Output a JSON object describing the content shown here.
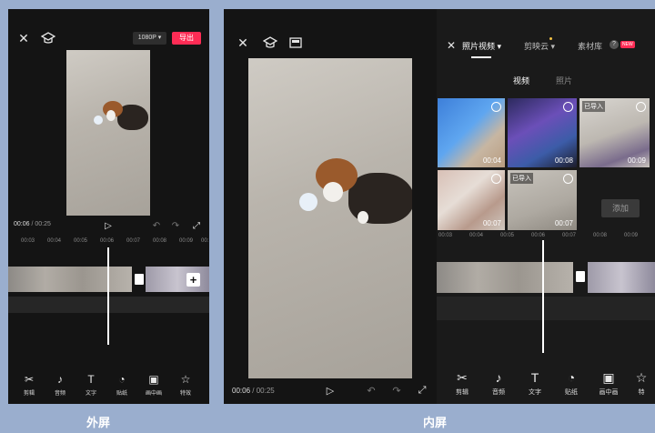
{
  "outer": {
    "caption": "外屏",
    "resolution": "1080P",
    "export_label": "导出",
    "time_current": "00:06",
    "time_total": "/ 00:25",
    "ruler": [
      "00:03",
      "00:04",
      "00:05",
      "00:06",
      "00:07",
      "00:08",
      "00:09",
      "00:"
    ],
    "tools": [
      {
        "label": "剪辑",
        "icon": "scissors-icon",
        "glyph": "✂"
      },
      {
        "label": "音频",
        "icon": "music-note-icon",
        "glyph": "♪"
      },
      {
        "label": "文字",
        "icon": "text-icon",
        "glyph": "T"
      },
      {
        "label": "贴纸",
        "icon": "sticker-icon",
        "glyph": "◔"
      },
      {
        "label": "画中画",
        "icon": "picture-in-picture-icon",
        "glyph": "▣"
      },
      {
        "label": "特效",
        "icon": "effects-star-icon",
        "glyph": "☆"
      }
    ]
  },
  "inner": {
    "caption": "内屏",
    "time_current": "00:06",
    "time_total": "/ 00:25",
    "tabs": {
      "photo_video": "照片视频",
      "cloud": "剪映云",
      "library": "素材库",
      "new_badge": "NEW",
      "help": "?"
    },
    "subtabs": {
      "video": "视频",
      "photo": "照片"
    },
    "thumbnails": [
      {
        "duration": "00:04",
        "imported": ""
      },
      {
        "duration": "00:08",
        "imported": ""
      },
      {
        "duration": "00:09",
        "imported": "已导入"
      },
      {
        "duration": "00:07",
        "imported": ""
      },
      {
        "duration": "00:07",
        "imported": "已导入"
      }
    ],
    "add_label": "添加",
    "ruler": [
      "00:03",
      "00:04",
      "00:05",
      "00:06",
      "00:07",
      "00:08",
      "00:09"
    ],
    "tools": [
      {
        "label": "剪辑",
        "icon": "scissors-icon",
        "glyph": "✂"
      },
      {
        "label": "音频",
        "icon": "music-note-icon",
        "glyph": "♪"
      },
      {
        "label": "文字",
        "icon": "text-icon",
        "glyph": "T"
      },
      {
        "label": "贴纸",
        "icon": "sticker-icon",
        "glyph": "◔"
      },
      {
        "label": "画中画",
        "icon": "picture-in-picture-icon",
        "glyph": "▣"
      },
      {
        "label": "特",
        "icon": "effects-star-icon",
        "glyph": "☆"
      }
    ]
  },
  "colors": {
    "export_red": "#fe2c55",
    "playhead": "#ffffff",
    "background": "#9aaece"
  }
}
